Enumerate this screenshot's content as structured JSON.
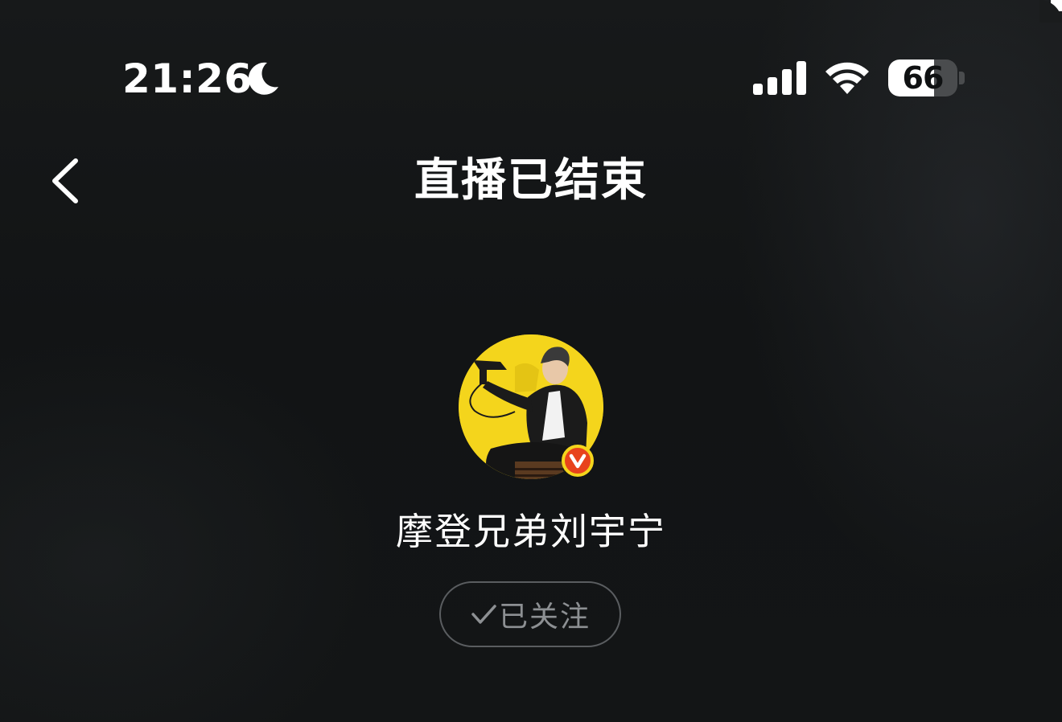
{
  "status_bar": {
    "time": "21:26",
    "focus_icon": "moon-icon",
    "signal_icon": "cellular-signal-icon",
    "wifi_icon": "wifi-icon",
    "battery_level": "66",
    "battery_fraction": 0.66
  },
  "nav": {
    "back_icon": "chevron-left-icon",
    "title": "直播已结束"
  },
  "profile": {
    "avatar": "host-avatar",
    "avatar_background": "#f4d51c",
    "verified_badge": "verified-v-badge-icon",
    "badge_color": "#e8431c",
    "name": "摩登兄弟刘宇宁",
    "follow_label": "已关注",
    "follow_icon": "check-icon"
  }
}
